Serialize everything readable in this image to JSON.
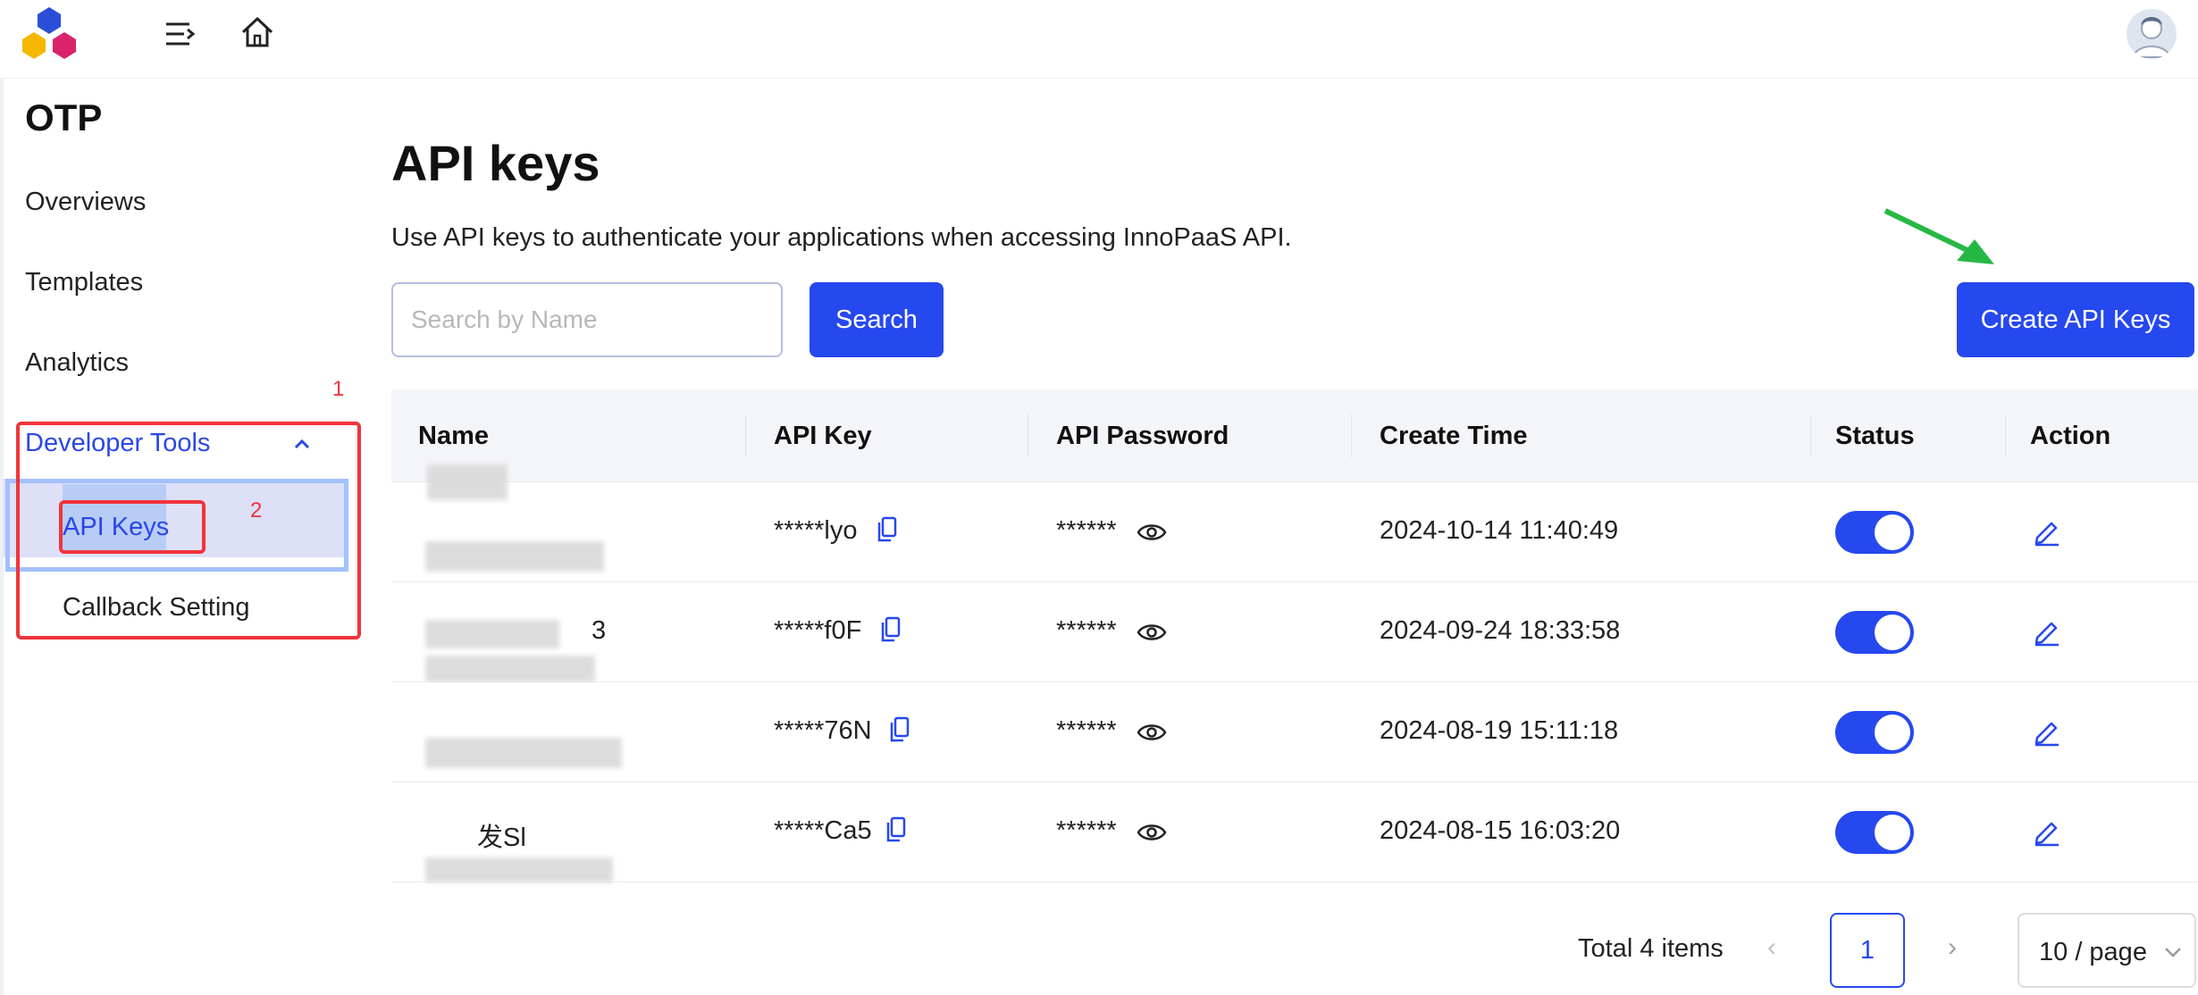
{
  "sidebar": {
    "title": "OTP",
    "items": [
      {
        "label": "Overviews"
      },
      {
        "label": "Templates"
      },
      {
        "label": "Analytics"
      },
      {
        "label": "Developer Tools"
      }
    ],
    "sub_items": [
      {
        "label": "API Keys"
      },
      {
        "label": "Callback Setting"
      }
    ]
  },
  "annotations": {
    "box1": "1",
    "box2": "2"
  },
  "main": {
    "title": "API keys",
    "description": "Use API keys to authenticate your applications when accessing InnoPaaS API.",
    "search_placeholder": "Search by Name",
    "search_button": "Search",
    "create_button": "Create API Keys"
  },
  "table": {
    "columns": [
      "Name",
      "API Key",
      "API Password",
      "Create Time",
      "Status",
      "Action"
    ],
    "rows": [
      {
        "name": "",
        "api_key": "*****lyo",
        "password": "******",
        "create_time": "2024-10-14 11:40:49",
        "status_on": true
      },
      {
        "name": "3",
        "api_key": "*****f0F",
        "password": "******",
        "create_time": "2024-09-24 18:33:58",
        "status_on": true
      },
      {
        "name": "",
        "api_key": "*****76N",
        "password": "******",
        "create_time": "2024-08-19 15:11:18",
        "status_on": true
      },
      {
        "name": "发Sl",
        "api_key": "*****Ca5",
        "password": "******",
        "create_time": "2024-08-15 16:03:20",
        "status_on": true
      }
    ]
  },
  "pagination": {
    "total": "Total 4 items",
    "current_page": "1",
    "page_size": "10 / page"
  },
  "colors": {
    "primary": "#2648ef",
    "annotation": "#f2333b",
    "arrow": "#27b844"
  }
}
